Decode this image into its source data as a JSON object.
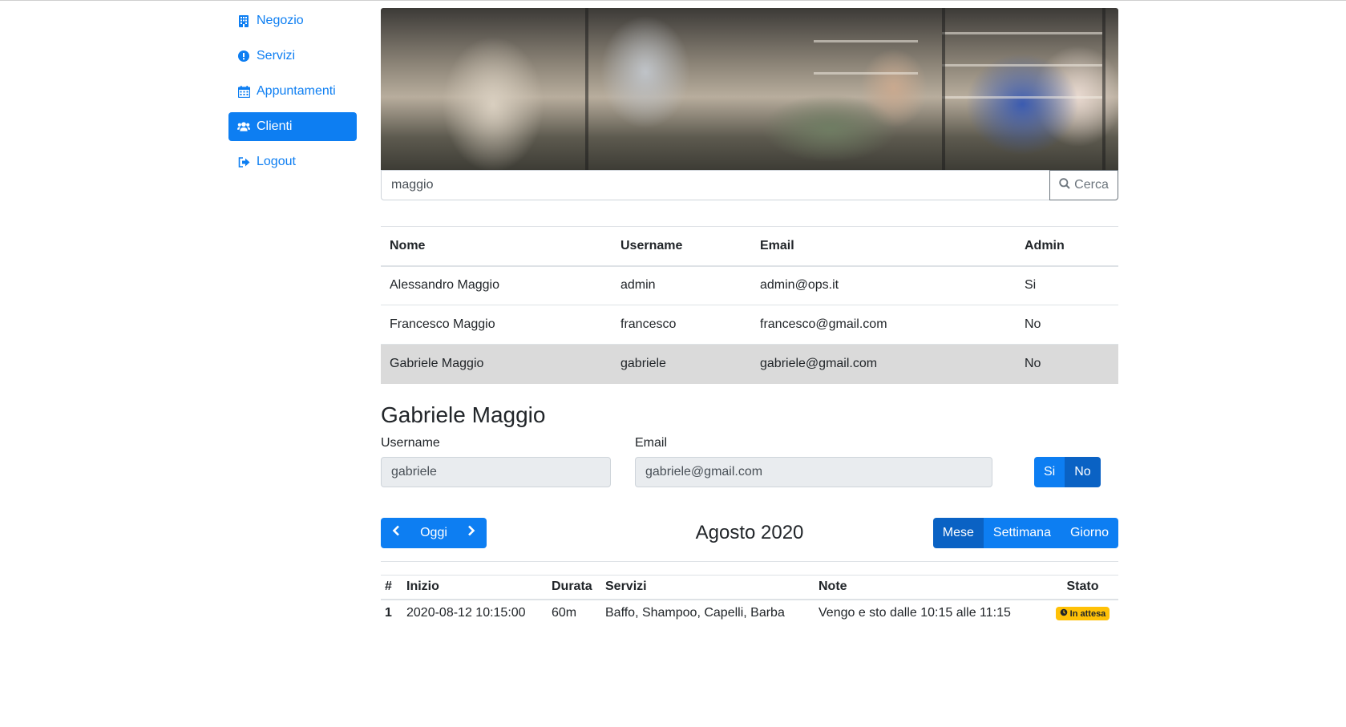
{
  "sidebar": {
    "items": [
      {
        "label": "Negozio",
        "icon": "building-icon"
      },
      {
        "label": "Servizi",
        "icon": "exclamation-circle-icon"
      },
      {
        "label": "Appuntamenti",
        "icon": "calendar-icon"
      },
      {
        "label": "Clienti",
        "icon": "users-icon",
        "active": true
      },
      {
        "label": "Logout",
        "icon": "sign-out-icon"
      }
    ]
  },
  "search": {
    "value": "maggio",
    "button_label": "Cerca"
  },
  "users_table": {
    "headers": [
      "Nome",
      "Username",
      "Email",
      "Admin"
    ],
    "rows": [
      [
        "Alessandro Maggio",
        "admin",
        "admin@ops.it",
        "Si"
      ],
      [
        "Francesco Maggio",
        "francesco",
        "francesco@gmail.com",
        "No"
      ],
      [
        "Gabriele Maggio",
        "gabriele",
        "gabriele@gmail.com",
        "No"
      ]
    ],
    "selected_row": 2
  },
  "detail": {
    "title": "Gabriele Maggio",
    "username_label": "Username",
    "username_value": "gabriele",
    "email_label": "Email",
    "email_value": "gabriele@gmail.com",
    "admin_yes": "Si",
    "admin_no": "No"
  },
  "calendar": {
    "today_label": "Oggi",
    "title": "Agosto 2020",
    "views": [
      "Mese",
      "Settimana",
      "Giorno"
    ],
    "active_view": "Mese"
  },
  "appointments": {
    "headers": [
      "#",
      "Inizio",
      "Durata",
      "Servizi",
      "Note",
      "Stato"
    ],
    "rows": [
      {
        "num": "1",
        "start": "2020-08-12 10:15:00",
        "duration": "60m",
        "services": "Baffo, Shampoo, Capelli, Barba",
        "note": "Vengo e sto dalle 10:15 alle 11:15",
        "status": "In attesa"
      }
    ]
  },
  "colors": {
    "primary": "#0d7ef2",
    "primary_active": "#0a62c4",
    "warning": "#ffc107",
    "selected_row": "#dadada"
  }
}
